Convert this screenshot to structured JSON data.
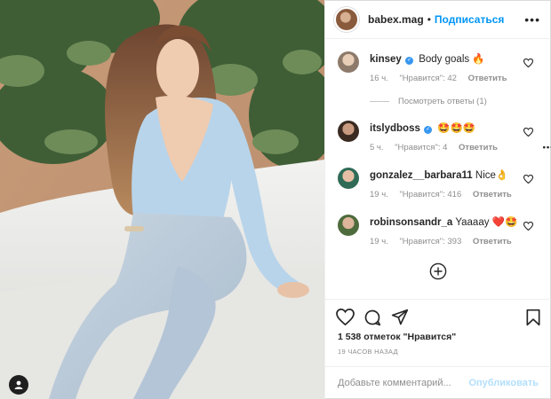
{
  "header": {
    "username": "babex.mag",
    "separator": "•",
    "follow_label": "Подписаться",
    "more_label": "•••"
  },
  "comments": [
    {
      "username": "kinsey",
      "verified": true,
      "text": "Body goals 🔥",
      "time": "16 ч.",
      "likes": "\"Нравится\": 42",
      "reply": "Ответить"
    },
    {
      "username": "itslydboss",
      "verified": true,
      "text": "🤩🤩🤩",
      "time": "5 ч.",
      "likes": "\"Нравится\": 4",
      "reply": "Ответить",
      "more": "•••"
    },
    {
      "username": "gonzalez__barbara11",
      "verified": false,
      "text": "Nice👌",
      "time": "19 ч.",
      "likes": "\"Нравится\": 416",
      "reply": "Ответить"
    },
    {
      "username": "robinsonsandr_a",
      "verified": false,
      "text": "Yaaaay ❤️🤩",
      "time": "19 ч.",
      "likes": "\"Нравится\": 393",
      "reply": "Ответить"
    }
  ],
  "view_replies_label": "Посмотреть ответы (1)",
  "likes_count": "1 538 отметок \"Нравится\"",
  "posted_time": "19 ЧАСОВ НАЗАД",
  "add_comment": {
    "placeholder": "Добавьте комментарий...",
    "publish_label": "Опубликовать"
  },
  "icons": {
    "heart": "heart-icon",
    "comment": "comment-icon",
    "share": "share-icon",
    "save": "bookmark-icon",
    "add": "plus-circle-icon",
    "user_tag": "user-icon"
  },
  "colors": {
    "accent": "#0095f6",
    "publish_disabled": "#b2dffc",
    "verified": "#3897f0"
  }
}
